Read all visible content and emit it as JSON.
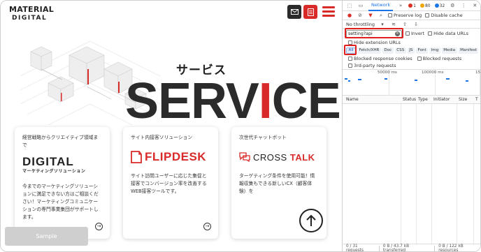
{
  "site": {
    "logo_line1": "MATERIAL",
    "logo_line2": "DIGITAL",
    "service_jp": "サービス",
    "service_en_prefix": "SERV",
    "service_en_red": "I",
    "service_en_suffix": "CE",
    "sample_button": "Sample",
    "brand_color": "#d92a2a",
    "cards": [
      {
        "heading": "経営戦略からクリエイティブ領域まで",
        "brand": "DIGITAL",
        "brand_sub": "マーケティングソリューション",
        "description": "今までのマーケティングソリューションに満足できない方はご相談ください！マーケティングコミュニケーションの専門事業集団がサポートします。"
      },
      {
        "heading": "サイト内接客ソリューション",
        "brand": "FLIPDESK",
        "description": "サイト訪問ユーザーに応じた集促と接客でコンバージョン率を改善するWEB接客ツールです。"
      },
      {
        "heading": "次世代チャットボット",
        "brand_part1": "CROSS",
        "brand_part2": "TALK",
        "description": "ターゲティング条件を使用可能！情報収集もできる新しいCX（顧客体験）を"
      }
    ]
  },
  "devtools": {
    "active_tab": "Network",
    "more_tabs": "»",
    "errors": "1",
    "warnings": "80",
    "info": "32",
    "preserve_log": "Preserve log",
    "disable_cache": "Disable cache",
    "throttling": "No throttling",
    "filter_value": "setting?api",
    "invert": "Invert",
    "hide_data_urls": "Hide data URLs",
    "hide_extension_urls": "Hide extension URLs",
    "types": [
      "All",
      "Fetch/XHR",
      "Doc",
      "CSS",
      "JS",
      "Font",
      "Img",
      "Media",
      "Manifest"
    ],
    "active_type": "All",
    "blocked_response_cookies": "Blocked response cookies",
    "blocked_requests": "Blocked requests",
    "third_party_requests": "3rd-party requests",
    "timeline_labels": [
      "50000 ms",
      "100000 ms",
      "15"
    ],
    "columns": [
      "Name",
      "Status",
      "Type",
      "Initiator",
      "Size",
      "T"
    ],
    "status_requests": "0 / 31 requests",
    "status_transferred": "0 B / 43.7 kB transferred",
    "status_resources": "0 B / 122 kB resources"
  }
}
